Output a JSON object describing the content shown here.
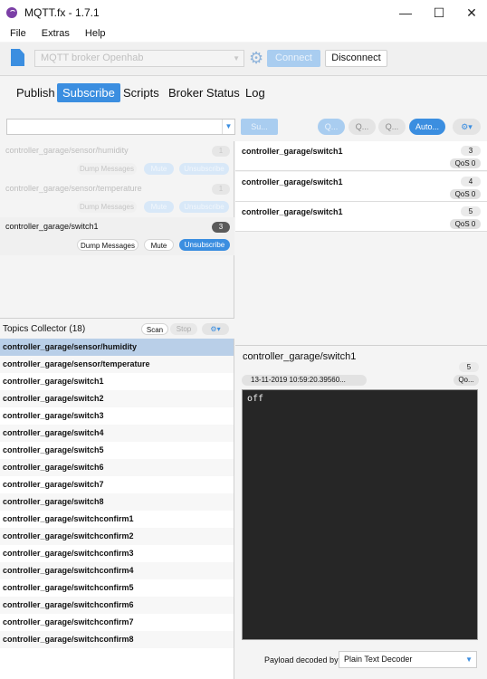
{
  "window": {
    "title": "MQTT.fx - 1.7.1",
    "minimize": "—",
    "maximize": "☐",
    "close": "✕"
  },
  "menu": [
    "File",
    "Extras",
    "Help"
  ],
  "toolbar": {
    "broker_profile": "MQTT broker Openhab",
    "connect_label": "Connect",
    "disconnect_label": "Disconnect"
  },
  "tabs": [
    {
      "label": "Publish",
      "active": false
    },
    {
      "label": "Subscribe",
      "active": true
    },
    {
      "label": "Scripts",
      "active": false
    },
    {
      "label": "Broker Status",
      "active": false
    },
    {
      "label": "Log",
      "active": false
    }
  ],
  "subscribe_bar": {
    "topic_value": "",
    "subscribe_label": "Su...",
    "qos0_label": "Q...",
    "qos1_label": "Q...",
    "qos2_label": "Q...",
    "autoscroll_label": "Auto...",
    "settings_label": "⚙▾"
  },
  "subscriptions": [
    {
      "topic": "controller_garage/sensor/humidity",
      "count": "1",
      "dump": "Dump Messages",
      "mute": "Mute",
      "unsubscribe": "Unsubscribe",
      "active": false
    },
    {
      "topic": "controller_garage/sensor/temperature",
      "count": "1",
      "dump": "Dump Messages",
      "mute": "Mute",
      "unsubscribe": "Unsubscribe",
      "active": false
    },
    {
      "topic": "controller_garage/switch1",
      "count": "3",
      "dump": "Dump Messages",
      "mute": "Mute",
      "unsubscribe": "Unsubscribe",
      "active": true
    }
  ],
  "messages": [
    {
      "topic": "controller_garage/switch1",
      "number": "3",
      "qos": "QoS 0"
    },
    {
      "topic": "controller_garage/switch1",
      "number": "4",
      "qos": "QoS 0"
    },
    {
      "topic": "controller_garage/switch1",
      "number": "5",
      "qos": "QoS 0"
    }
  ],
  "topics_collector": {
    "title": "Topics Collector (18)",
    "scan_label": "Scan",
    "stop_label": "Stop",
    "settings_label": "⚙▾",
    "topics": [
      "controller_garage/sensor/humidity",
      "controller_garage/sensor/temperature",
      "controller_garage/switch1",
      "controller_garage/switch2",
      "controller_garage/switch3",
      "controller_garage/switch4",
      "controller_garage/switch5",
      "controller_garage/switch6",
      "controller_garage/switch7",
      "controller_garage/switch8",
      "controller_garage/switchconfirm1",
      "controller_garage/switchconfirm2",
      "controller_garage/switchconfirm3",
      "controller_garage/switchconfirm4",
      "controller_garage/switchconfirm5",
      "controller_garage/switchconfirm6",
      "controller_garage/switchconfirm7",
      "controller_garage/switchconfirm8"
    ],
    "selected_index": 0
  },
  "detail": {
    "topic": "controller_garage/switch1",
    "number": "5",
    "timestamp": "13-11-2019  10:59:20.39560...",
    "qos": "Qo...",
    "payload": "off",
    "decoder_label": "Payload decoded by",
    "decoder_value": "Plain Text Decoder"
  },
  "colors": {
    "accent": "#3b8ee0",
    "selected_row": "#b9cfe8",
    "payload_bg": "#262626"
  }
}
